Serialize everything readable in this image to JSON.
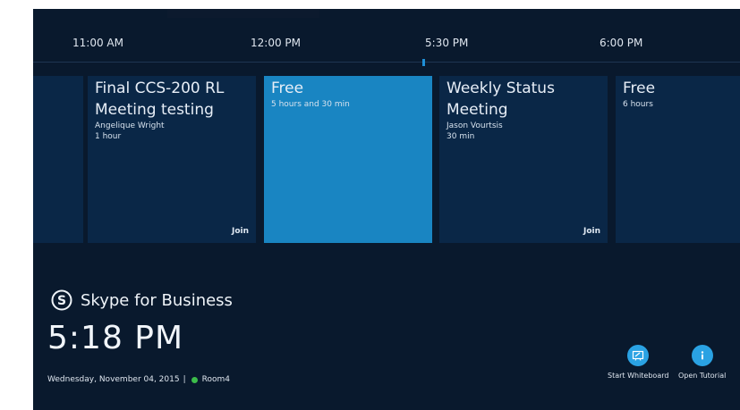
{
  "timeline": {
    "labels": [
      "11:00 AM",
      "12:00 PM",
      "5:30 PM",
      "6:00 PM"
    ]
  },
  "meetings": [
    {
      "title": "Final CCS-200 RL Meeting testing",
      "organizer": "Angelique Wright",
      "duration": "1 hour",
      "action": "Join"
    },
    {
      "title": "Free",
      "duration": "5 hours and 30 min"
    },
    {
      "title": "Weekly Status Meeting",
      "organizer": "Jason Vourtsis",
      "duration": "30 min",
      "action": "Join"
    },
    {
      "title": "Free",
      "duration": "6 hours"
    }
  ],
  "brand": {
    "name": "Skype for Business",
    "logo_icon": "skype-logo-icon"
  },
  "clock": {
    "time": "5:18 PM"
  },
  "date_line": {
    "date": "Wednesday, November 04, 2015",
    "separator": "|",
    "room": "Room4"
  },
  "actions": [
    {
      "label": "Start Whiteboard",
      "icon": "whiteboard-icon"
    },
    {
      "label": "Open Tutorial",
      "icon": "info-icon"
    }
  ],
  "colors": {
    "background": "#09192d",
    "meeting_tile": "#0a2747",
    "free_tile": "#1985c2",
    "accent": "#2aa2e3",
    "presence_available": "#3cbc4a"
  }
}
